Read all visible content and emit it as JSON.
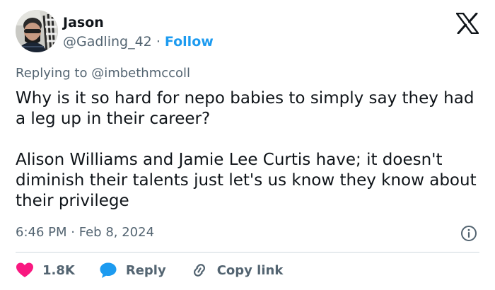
{
  "tweet": {
    "author": {
      "display_name": "Jason",
      "handle": "@Gadling_42",
      "separator": "·",
      "follow_label": "Follow",
      "avatar": "avatar-photo"
    },
    "platform_icon": "x-logo-icon",
    "replying_to_prefix": "Replying to",
    "replying_to_handle": "@imbethmccoll",
    "text_paragraphs": [
      "Why is it so hard for nepo babies to simply say they had a leg up in their career?",
      "Alison Williams and Jamie Lee Curtis have; it doesn't diminish their talents just let's us know they know about their privilege"
    ],
    "time": "6:46 PM",
    "date_separator": "·",
    "date": "Feb 8, 2024",
    "info_icon": "info-icon",
    "actions": {
      "like": {
        "icon": "heart-icon",
        "count": "1.8K",
        "color": "#f91880"
      },
      "reply": {
        "icon": "speech-bubble-icon",
        "label": "Reply",
        "color": "#1d9bf0"
      },
      "copy_link": {
        "icon": "link-icon",
        "label": "Copy link"
      }
    },
    "colors": {
      "accent": "#1d9bf0",
      "secondary_text": "#536471",
      "primary_text": "#0f1419",
      "divider": "#cfd9de"
    }
  }
}
